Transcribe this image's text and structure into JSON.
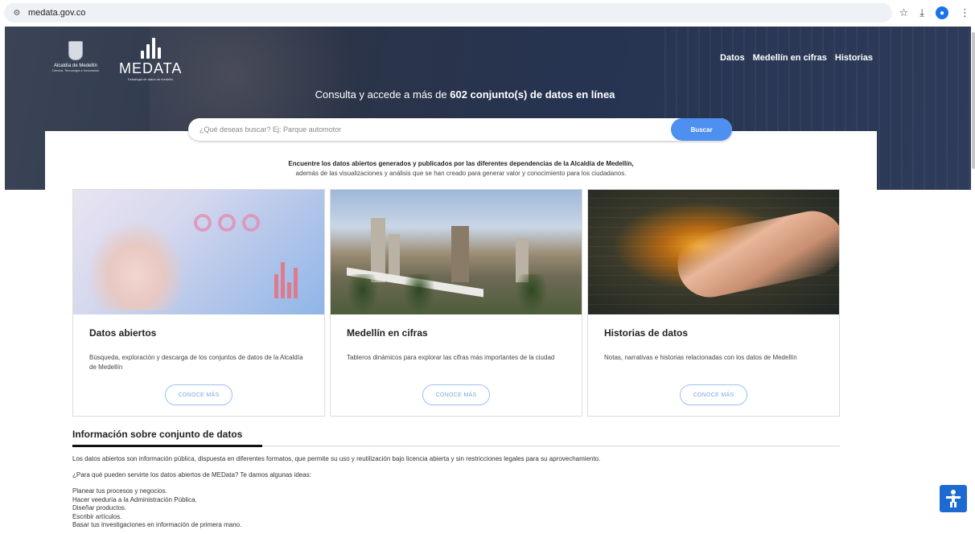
{
  "browser": {
    "url": "medata.gov.co",
    "site_info_icon": "tune-icon",
    "actions": [
      "star-icon",
      "download-icon",
      "profile-icon",
      "kebab-menu-icon"
    ]
  },
  "header": {
    "alcaldia_name": "Alcaldía de Medellín",
    "alcaldia_sub": "Ciencia, Tecnología e Innovación",
    "brand": "MEDATA",
    "brand_sub": "Estrategia de datos de medellín",
    "nav": [
      "Datos",
      "Medellín en cifras",
      "Historias"
    ],
    "headline_prefix": "Consulta y accede a más de ",
    "headline_bold": "602 conjunto(s) de datos en línea"
  },
  "search": {
    "placeholder": "¿Qué deseas buscar? Ej: Parque automotor",
    "button": "Buscar"
  },
  "intro": {
    "line1": "Encuentre los datos abiertos generados y publicados por las diferentes dependencias de la Alcaldía de Medellín,",
    "line2": "además de las visualizaciones y análisis que se han creado para generar valor y conocimiento para los ciudadanos."
  },
  "cards": [
    {
      "title": "Datos abiertos",
      "description": "Búsqueda, exploración y descarga de los conjuntos de datos de la Alcaldía de Medellín",
      "button": "CONOCE MÁS"
    },
    {
      "title": "Medellín en cifras",
      "description": "Tableros dinámicos para explorar las cifras más importantes de la ciudad",
      "button": "CONOCE MÁS"
    },
    {
      "title": "Historias de datos",
      "description": "Notas, narrativas e historias relacionadas con los datos de Medellín",
      "button": "CONOCE MÁS"
    }
  ],
  "info": {
    "title": "Información sobre conjunto de datos",
    "p1": "Los datos abiertos son información pública, dispuesta en diferentes formatos, que permite su uso y reutilización bajo licencia abierta y sin restricciones legales para su aprovechamiento.",
    "p2": "¿Para qué pueden servirte los datos abiertos de MEData? Te damos algunas ideas:",
    "ideas": [
      "Planear tus procesos y negocios.",
      "Hacer veeduría a la Administración Pública.",
      "Diseñar productos.",
      "Escribir artículos.",
      "Basar tus investigaciones en información de primera mano."
    ]
  },
  "colors": {
    "accent": "#4d90f0",
    "hero_bg": "#2b3448",
    "a11y": "#1d6ad2"
  }
}
